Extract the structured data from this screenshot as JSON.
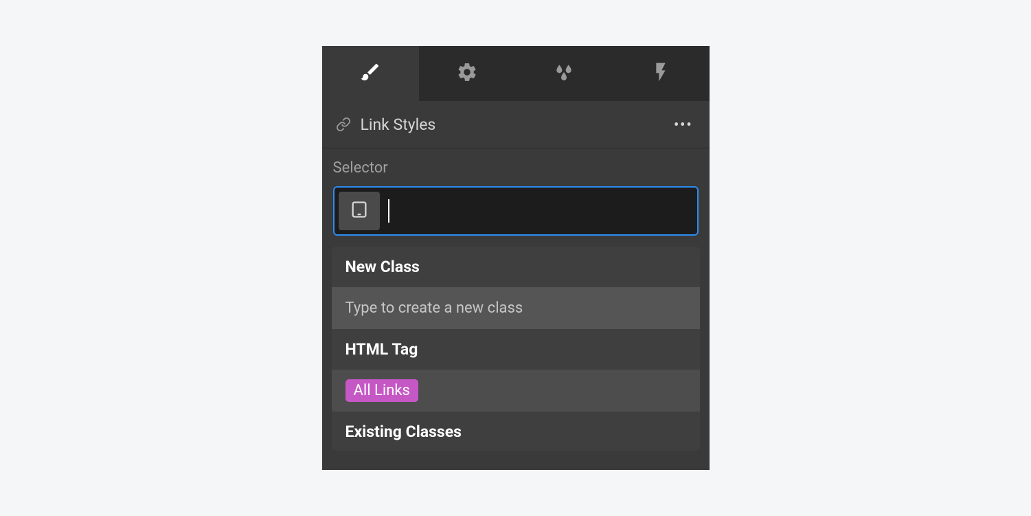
{
  "tabs": [
    {
      "name": "brush",
      "active": true
    },
    {
      "name": "gear",
      "active": false
    },
    {
      "name": "drops",
      "active": false
    },
    {
      "name": "bolt",
      "active": false
    }
  ],
  "header": {
    "title": "Link Styles"
  },
  "selector": {
    "label": "Selector",
    "value": ""
  },
  "dropdown": {
    "new_class_header": "New Class",
    "new_class_hint": "Type to create a new class",
    "html_tag_header": "HTML Tag",
    "html_tag_value": "All Links",
    "existing_header": "Existing Classes"
  },
  "colors": {
    "accent": "#2d8cf0",
    "tag_pill": "#c658c6"
  }
}
